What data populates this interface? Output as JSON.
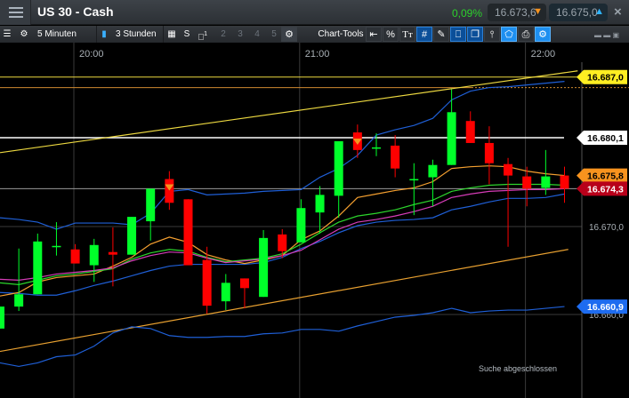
{
  "header": {
    "title": "US 30 - Cash",
    "change": "0,09%",
    "bid": "16.673,6",
    "ask": "16.675,0",
    "bid_icon": "flame-down-icon",
    "ask_icon": "flame-up-icon",
    "close_icon": "×"
  },
  "toolbar": {
    "interval": "5 Minuten",
    "range": "3 Stunden",
    "s_label": "S",
    "layout_1": "1",
    "layouts": [
      "2",
      "3",
      "4",
      "5"
    ],
    "chart_tools": "Chart-Tools",
    "percent": "%",
    "text_tool": "Tт",
    "grid": "#"
  },
  "time_axis": [
    "20:00",
    "21:00",
    "22:00"
  ],
  "status": "Suche abgeschlossen",
  "colors": {
    "up": "#00ff2a",
    "down": "#ff0000",
    "band": "#1f5fd6",
    "ma_orange": "#f5a030",
    "ma_green": "#2cd62c",
    "ma_magenta": "#d63cb8",
    "trend_yellow": "#ecd840",
    "trend_orange": "#e8a030"
  },
  "chart_data": {
    "type": "candlestick",
    "interval": "5 Minuten",
    "ylim": [
      16652,
      16693
    ],
    "price_ticks": [
      {
        "value": 16670,
        "label": "16.670,0"
      },
      {
        "value": 16660,
        "label": "16.660,0"
      }
    ],
    "price_labels": [
      {
        "value": 16687.0,
        "label": "16.687,0",
        "color": "#ffee22",
        "text": "#000"
      },
      {
        "value": 16680.1,
        "label": "16.680,1",
        "color": "#ffffff",
        "text": "#000"
      },
      {
        "value": 16675.8,
        "label": "16.675,8",
        "color": "#f7931e",
        "text": "#000"
      },
      {
        "value": 16674.3,
        "label": "16.674,3",
        "color": "#b8001a",
        "text": "#fff"
      },
      {
        "value": 16660.9,
        "label": "16.660,9",
        "color": "#1e6cf0",
        "text": "#fff"
      }
    ],
    "time_ticks": [
      {
        "index": 4,
        "label": "20:00"
      },
      {
        "index": 16,
        "label": "21:00"
      },
      {
        "index": 28,
        "label": "22:00"
      }
    ],
    "candles": [
      [
        16658.4,
        16660.9,
        16658.4,
        16660.9
      ],
      [
        16660.9,
        16667.5,
        16660.4,
        16662.3
      ],
      [
        16662.3,
        16669.2,
        16662.3,
        16668.3
      ],
      [
        16667.8,
        16670.5,
        16666.7,
        16667.8
      ],
      [
        16667.4,
        16668.0,
        16665.8,
        16665.8
      ],
      [
        16665.6,
        16668.6,
        16663.7,
        16667.9
      ],
      [
        16667.1,
        16669.9,
        16663.2,
        16666.8
      ],
      [
        16666.8,
        16671.1,
        16666.8,
        16671.1
      ],
      [
        16670.6,
        16674.3,
        16668.4,
        16674.3
      ],
      [
        16675.4,
        16676.3,
        16671.9,
        16672.7
      ],
      [
        16673.1,
        16673.1,
        16665.6,
        16665.6
      ],
      [
        16666.2,
        16667.7,
        16660.1,
        16661.0
      ],
      [
        16661.5,
        16664.6,
        16660.5,
        16663.6
      ],
      [
        16664.1,
        16664.1,
        16660.7,
        16663.0
      ],
      [
        16662.0,
        16669.6,
        16662.0,
        16668.7
      ],
      [
        16669.1,
        16669.7,
        16666.4,
        16667.2
      ],
      [
        16668.2,
        16673.1,
        16668.2,
        16672.1
      ],
      [
        16671.6,
        16674.6,
        16669.2,
        16673.6
      ],
      [
        16673.5,
        16679.7,
        16671.0,
        16679.7
      ],
      [
        16680.7,
        16681.6,
        16677.8,
        16678.7
      ],
      [
        16679.0,
        16680.6,
        16678.0,
        16679.0
      ],
      [
        16679.2,
        16680.4,
        16675.6,
        16676.6
      ],
      [
        16675.4,
        16677.2,
        16671.3,
        16675.4
      ],
      [
        16675.6,
        16677.6,
        16672.3,
        16677.0
      ],
      [
        16677.0,
        16685.6,
        16677.0,
        16683.0
      ],
      [
        16682.0,
        16683.1,
        16679.5,
        16679.5
      ],
      [
        16679.5,
        16681.4,
        16674.8,
        16677.2
      ],
      [
        16677.1,
        16677.8,
        16667.7,
        16675.8
      ],
      [
        16675.7,
        16676.8,
        16672.3,
        16674.3
      ],
      [
        16674.4,
        16678.7,
        16673.6,
        16675.7
      ],
      [
        16675.8,
        16676.8,
        16672.7,
        16674.3
      ]
    ],
    "candle_fields": [
      "open",
      "high",
      "low",
      "close"
    ],
    "indicators": [
      {
        "color": "#1f5fd6",
        "values": [
          16671.0,
          16670.8,
          16670.5,
          16669.7,
          16670.4,
          16670.4,
          16670.4,
          16670.2,
          16671.5,
          16674.0,
          16674.2,
          16673.6,
          16673.7,
          16673.8,
          16674.0,
          16674.1,
          16674.2,
          16675.6,
          16676.6,
          16678.1,
          16680.4,
          16681.0,
          16681.5,
          16682.3,
          16684.4,
          16685.4,
          16685.8,
          16685.9,
          16686.1,
          16686.3,
          16686.5
        ]
      },
      {
        "color": "#1f5fd6",
        "values": [
          16662.5,
          16662.4,
          16662.2,
          16662.2,
          16662.7,
          16663.3,
          16663.8,
          16664.4,
          16665.0,
          16665.5,
          16665.7,
          16665.7,
          16665.7,
          16665.7,
          16665.9,
          16666.5,
          16667.5,
          16668.3,
          16669.3,
          16670.1,
          16670.5,
          16670.7,
          16670.8,
          16671.0,
          16671.9,
          16672.3,
          16672.8,
          16673.2,
          16673.2,
          16673.3,
          16673.7
        ]
      },
      {
        "color": "#f5a030",
        "values": [
          16662.1,
          16662.5,
          16663.7,
          16664.2,
          16664.4,
          16664.6,
          16665.5,
          16666.5,
          16668.0,
          16668.8,
          16668.2,
          16666.8,
          16666.2,
          16665.8,
          16666.2,
          16666.7,
          16668.5,
          16669.5,
          16671.2,
          16673.3,
          16673.7,
          16674.1,
          16674.4,
          16675.1,
          16676.6,
          16676.8,
          16676.9,
          16676.8,
          16676.3,
          16676.0,
          16675.8
        ]
      },
      {
        "color": "#2cd62c",
        "values": [
          16663.6,
          16663.4,
          16663.9,
          16664.4,
          16664.6,
          16664.9,
          16665.2,
          16666.3,
          16667.0,
          16667.4,
          16667.2,
          16666.5,
          16666.0,
          16666.2,
          16666.4,
          16666.9,
          16668.0,
          16669.3,
          16670.5,
          16671.2,
          16671.5,
          16671.9,
          16672.5,
          16673.0,
          16674.0,
          16674.4,
          16674.7,
          16674.8,
          16674.8,
          16674.8,
          16674.7
        ]
      },
      {
        "color": "#d63cb8",
        "values": [
          16664.0,
          16663.9,
          16664.2,
          16664.6,
          16664.8,
          16665.0,
          16665.3,
          16666.1,
          16666.7,
          16667.1,
          16667.0,
          16666.4,
          16665.9,
          16666.1,
          16666.3,
          16666.7,
          16667.3,
          16668.5,
          16669.7,
          16670.5,
          16670.8,
          16671.2,
          16671.7,
          16672.3,
          16673.3,
          16673.7,
          16674.0,
          16674.1,
          16674.2,
          16674.2,
          16674.3
        ]
      },
      {
        "color": "#1f5fd6",
        "values": [
          16654.5,
          16654.1,
          16654.5,
          16655.2,
          16655.4,
          16656.4,
          16657.9,
          16658.6,
          16658.4,
          16657.6,
          16657.4,
          16657.4,
          16657.5,
          16657.5,
          16657.8,
          16657.9,
          16658.3,
          16658.3,
          16658.1,
          16658.7,
          16659.2,
          16659.7,
          16659.9,
          16660.2,
          16660.7,
          16660.2,
          16660.4,
          16660.5,
          16660.5,
          16660.7,
          16660.9
        ]
      }
    ],
    "trendlines": [
      {
        "color": "#ecd840",
        "from": [
          0,
          16678.4
        ],
        "to": [
          30.7,
          16687.7
        ]
      },
      {
        "color": "#e8a030",
        "from": [
          0,
          16655.8
        ],
        "to": [
          30.2,
          16667.4
        ]
      }
    ],
    "horizontal_lines": [
      {
        "value": 16687.0,
        "color": "#ecd840"
      },
      {
        "value": 16685.8,
        "color": "#d08a30"
      },
      {
        "value": 16680.1,
        "color": "#ffffff"
      },
      {
        "value": 16674.3,
        "color": "#9a9a9a"
      }
    ],
    "signal_markers": [
      {
        "index": 9,
        "value": 16674.5
      },
      {
        "index": 19,
        "value": 16679.7
      }
    ]
  }
}
